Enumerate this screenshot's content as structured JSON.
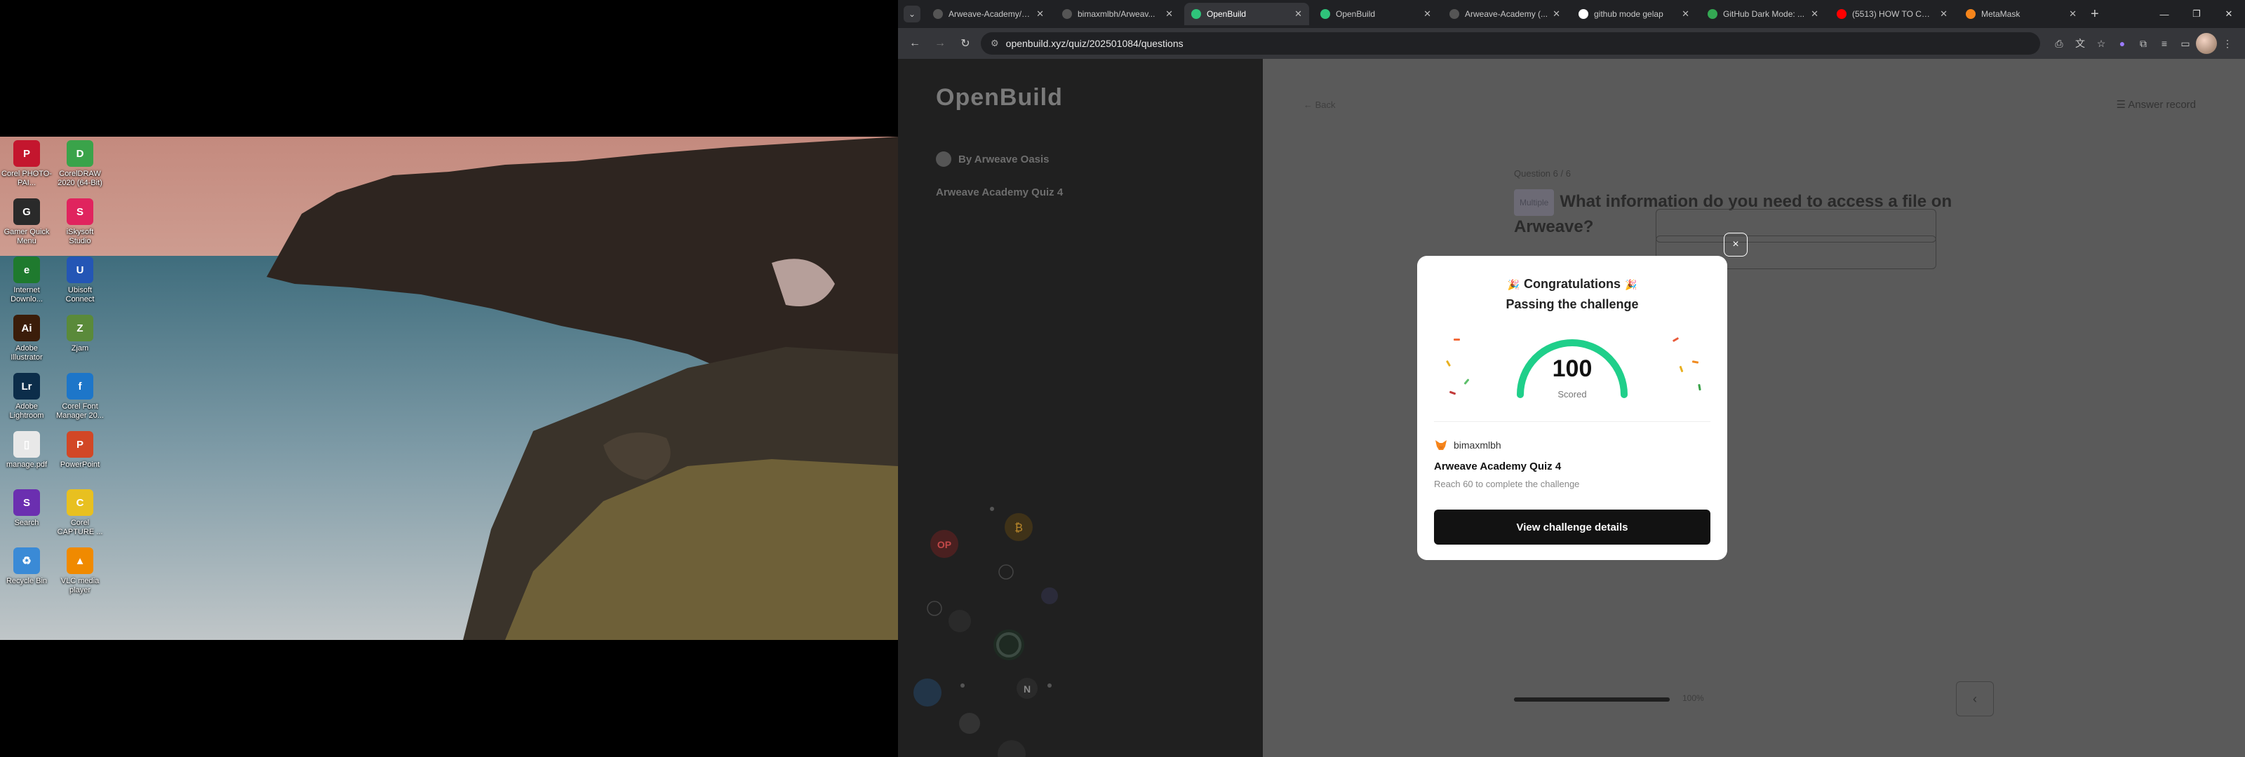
{
  "desktop": {
    "icons": [
      {
        "label": "Corel PHOTO-PAI...",
        "glyph": "P",
        "color": "#c4162e"
      },
      {
        "label": "CorelDRAW 2020 (64-Bit)",
        "glyph": "D",
        "color": "#3aa34a"
      },
      {
        "label": "Gamer Quick Menu",
        "glyph": "G",
        "color": "#2a2a2a"
      },
      {
        "label": "iSkysoft Studio",
        "glyph": "S",
        "color": "#e0245e"
      },
      {
        "label": "Internet Downlo...",
        "glyph": "e",
        "color": "#1f7a2e"
      },
      {
        "label": "Ubisoft Connect",
        "glyph": "U",
        "color": "#2456b5"
      },
      {
        "label": "Adobe Illustrator",
        "glyph": "Ai",
        "color": "#3b1d0a"
      },
      {
        "label": "Zjam",
        "glyph": "Z",
        "color": "#5a8a3a"
      },
      {
        "label": "Adobe Lightroom",
        "glyph": "Lr",
        "color": "#0c2d4a"
      },
      {
        "label": "Corel Font Manager 20...",
        "glyph": "f",
        "color": "#1d76c9"
      },
      {
        "label": "manage.pdf",
        "glyph": "▯",
        "color": "#e8e8e8"
      },
      {
        "label": "PowerPoint",
        "glyph": "P",
        "color": "#d24726"
      },
      {
        "label": "Search",
        "glyph": "S",
        "color": "#6b2fb0"
      },
      {
        "label": "Corel CAPTURE ...",
        "glyph": "C",
        "color": "#e8c020"
      },
      {
        "label": "Recycle Bin",
        "glyph": "♻",
        "color": "#3a8ad6"
      },
      {
        "label": "VLC media player",
        "glyph": "▲",
        "color": "#f08a00"
      }
    ]
  },
  "browser": {
    "tabs": [
      {
        "title": "Arweave-Academy/h...",
        "active": false,
        "icon": "github-icon",
        "fav": "#555"
      },
      {
        "title": "bimaxmlbh/Arweav...",
        "active": false,
        "icon": "github-icon",
        "fav": "#555"
      },
      {
        "title": "OpenBuild",
        "active": true,
        "icon": "openbuild-icon",
        "fav": "#2fc37a"
      },
      {
        "title": "OpenBuild",
        "active": false,
        "icon": "openbuild-icon",
        "fav": "#2fc37a"
      },
      {
        "title": "Arweave-Academy (...",
        "active": false,
        "icon": "github-icon",
        "fav": "#555"
      },
      {
        "title": "github mode gelap",
        "active": false,
        "icon": "google-icon",
        "fav": "#ffffff"
      },
      {
        "title": "GitHub Dark Mode: ...",
        "active": false,
        "icon": "docs-icon",
        "fav": "#34a853"
      },
      {
        "title": "(5513) HOW TO CON...",
        "active": false,
        "icon": "youtube-icon",
        "fav": "#ff0000"
      },
      {
        "title": "MetaMask",
        "active": false,
        "icon": "metamask-icon",
        "fav": "#f6851b"
      }
    ],
    "url": "openbuild.xyz/quiz/202501084/questions",
    "new_tab": "+"
  },
  "sidebar": {
    "logo": "OpenBuild",
    "byline": "By Arweave Oasis",
    "quiz_name": "Arweave Academy Quiz 4"
  },
  "question": {
    "back_label": "Back",
    "answer_record_label": "Answer record",
    "counter": "Question 6 / 6",
    "badge": "Multiple",
    "text": "What information do you need to access a file on Arweave?",
    "progress_label": "100%",
    "progress_fraction": 1.0,
    "prev_arrow": "‹"
  },
  "modal": {
    "title_line1": "Congratulations",
    "title_line2": "Passing the challenge",
    "party_emoji": "🎉",
    "score": "100",
    "score_label": "Scored",
    "score_fraction": 1.0,
    "username": "bimaxmlbh",
    "challenge_title": "Arweave Academy Quiz 4",
    "challenge_subtitle": "Reach 60 to complete the challenge",
    "cta_label": "View challenge details",
    "close_icon": "×",
    "gauge_color": "#1fcf8a"
  },
  "orbit_tokens": [
    {
      "label": "OP",
      "color": "#d93a3a"
    },
    {
      "label": "₿",
      "color": "#c98a1a"
    },
    {
      "label": "N",
      "color": "#444"
    },
    {
      "label": "💧",
      "color": "#3f6fae"
    },
    {
      "label": "≡",
      "color": "#555"
    }
  ]
}
